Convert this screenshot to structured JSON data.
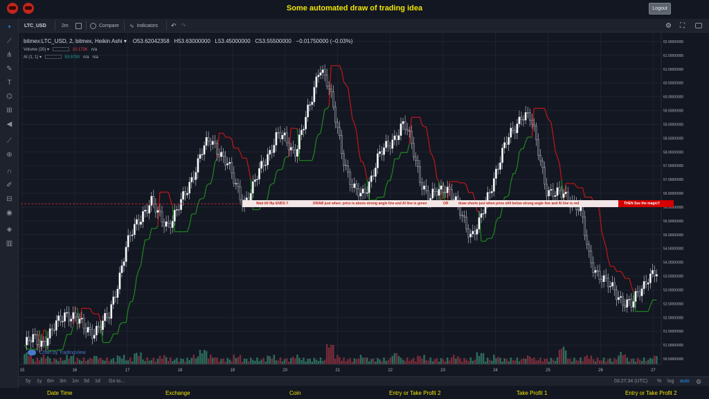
{
  "app": {
    "title": "Some automated draw of trading idea",
    "logout_label": "Logout"
  },
  "toolbar": {
    "symbol": "LTC_USD",
    "interval": "2m",
    "compare_label": "Compare",
    "indicators_label": "Indicators"
  },
  "legend": {
    "main": "bitmex:LTC_USD, 2, bitmex, Heikin Ashi",
    "open": "O53.62042358",
    "high": "H53.63000000",
    "low": "L53.45000000",
    "close": "C53.55500000",
    "change": "−0.01750000 (−0.03%)",
    "volume_label": "Volume (20)",
    "volume_value": "10.173K",
    "volume_na": "n/a",
    "ai_label": "AI (1, 1)",
    "ai_value": "53.5750",
    "ai_na1": "n/a",
    "ai_na2": "n/a"
  },
  "banner": {
    "part1": "Wait till flip ENDS !!",
    "part2": "DRAW just when: price is above strong angle line and AI line is green",
    "part3": "OR",
    "part4": "draw shorts just when price still below strong angle line and AI line is red",
    "end": "THEN See the magic!!"
  },
  "watermark": "Chart by TradingView",
  "rangebar": {
    "ranges": [
      "5y",
      "1y",
      "6m",
      "3m",
      "1m",
      "5d",
      "1d"
    ],
    "goto": "Go to...",
    "time": "03:27:34 (UTC)",
    "percent": "%",
    "log": "log",
    "auto": "auto"
  },
  "footer": {
    "items": [
      "Date Time",
      "Exchange",
      "Coin",
      "Entry or Take Profit 2",
      "Take Profit 1",
      "Entry or Take Profit 2"
    ]
  },
  "chart_data": {
    "type": "candlestick",
    "price_axis_labels": [
      "62.00000000",
      "61.50000000",
      "61.00000000",
      "60.50000000",
      "60.00000000",
      "59.50000000",
      "59.00000000",
      "58.50000000",
      "58.00000000",
      "57.50000000",
      "57.00000000",
      "56.50000000",
      "56.00000000",
      "55.50000000",
      "55.00000000",
      "54.50000000",
      "54.00000000",
      "53.50000000",
      "53.00000000",
      "52.50000000",
      "52.00000000",
      "51.50000000",
      "51.00000000",
      "50.50000000"
    ],
    "ylim": [
      50.3,
      62.3
    ],
    "time_labels": [
      "15",
      "16",
      "17",
      "18",
      "19",
      "20",
      "21",
      "22",
      "23",
      "24",
      "25",
      "26",
      "27"
    ],
    "price_marker": "56.11905966",
    "last_price": "53.55500000",
    "series": [
      {
        "name": "AI",
        "color_up": "#1e8a1e",
        "color_down": "#c21818"
      }
    ],
    "colors": {
      "up": "#ffffff",
      "down": "#2a2e39",
      "vol_up": "#2e6b5c",
      "vol_down": "#7a2c3a",
      "marker": "#c62828"
    },
    "price_path": [
      51.0,
      51.2,
      51.1,
      51.4,
      51.8,
      52.2,
      52.0,
      51.6,
      51.5,
      51.7,
      52.0,
      53.2,
      54.5,
      55.2,
      55.8,
      56.2,
      55.6,
      55.4,
      55.8,
      56.4,
      57.2,
      58.0,
      58.4,
      58.1,
      57.6,
      56.8,
      56.2,
      56.6,
      57.4,
      58.0,
      58.6,
      58.4,
      58.0,
      58.8,
      59.8,
      61.2,
      60.4,
      59.0,
      57.6,
      56.6,
      56.4,
      57.0,
      57.8,
      58.2,
      58.6,
      59.0,
      58.2,
      57.0,
      56.2,
      56.6,
      56.8,
      56.2,
      55.6,
      55.0,
      55.4,
      56.4,
      57.4,
      58.2,
      58.8,
      59.4,
      59.2,
      58.0,
      56.6,
      56.4,
      56.5,
      56.2,
      55.8,
      54.2,
      53.6,
      53.2,
      53.0,
      52.6,
      52.4,
      53.0,
      53.5,
      53.55
    ],
    "volume": [
      3,
      1,
      2,
      1,
      1,
      2,
      1,
      1,
      2,
      1,
      1,
      2,
      1,
      3,
      1,
      1,
      2,
      1,
      1,
      1,
      2,
      4,
      2,
      1,
      1,
      2,
      1,
      1,
      1,
      2,
      1,
      1,
      2,
      1,
      1,
      1,
      6,
      2,
      1,
      1,
      2,
      1,
      1,
      1,
      3,
      1,
      1,
      2,
      1,
      1,
      1,
      2,
      1,
      1,
      3,
      1,
      2,
      1,
      1,
      1,
      2,
      1,
      1,
      1,
      5,
      1,
      1,
      2,
      1,
      1,
      1,
      3,
      1,
      1,
      1,
      2
    ]
  }
}
